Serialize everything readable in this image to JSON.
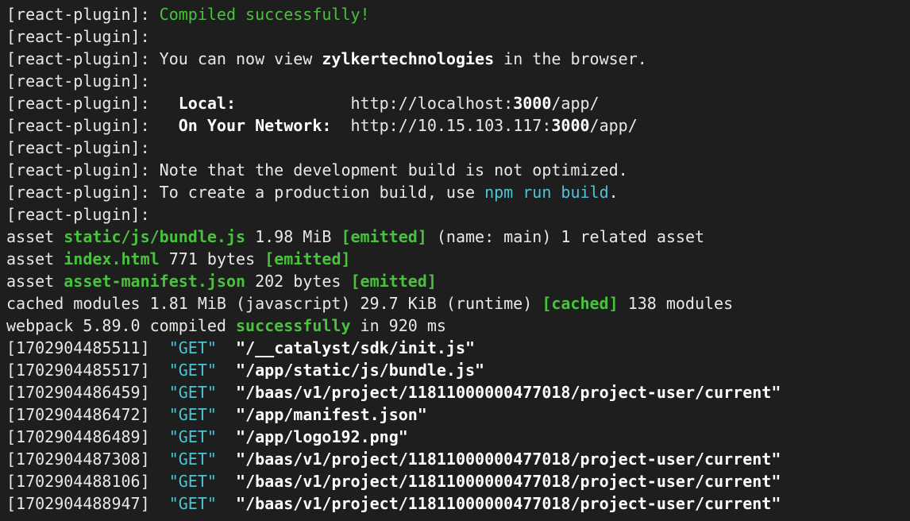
{
  "terminal": {
    "prefix": "[react-plugin]:",
    "compiled_msg": "Compiled successfully!",
    "view_intro": "You can now view",
    "app_name": "zylkertechnologies",
    "view_outro": "in the browser.",
    "local_label": "Local:",
    "local_url_pre": "http://localhost:",
    "local_port": "3000",
    "local_url_post": "/app/",
    "network_label": "On Your Network:",
    "network_url_pre": "http://10.15.103.117:",
    "network_port": "3000",
    "network_url_post": "/app/",
    "note_msg": "Note that the development build is not optimized.",
    "create_pre": "To create a production build, use",
    "create_cmd": "npm run build",
    "create_post": ".",
    "assets": [
      {
        "name": "static/js/bundle.js",
        "size": "1.98 MiB",
        "status": "[emitted]",
        "extra": "(name: main) 1 related asset"
      },
      {
        "name": "index.html",
        "size": "771 bytes",
        "status": "[emitted]",
        "extra": ""
      },
      {
        "name": "asset-manifest.json",
        "size": "202 bytes",
        "status": "[emitted]",
        "extra": ""
      }
    ],
    "asset_word": "asset",
    "cached_pre": "cached modules 1.81 MiB (javascript) 29.7 KiB (runtime)",
    "cached_tag": "[cached]",
    "cached_post": "138 modules",
    "webpack_pre": "webpack 5.89.0 compiled",
    "webpack_status": "successfully",
    "webpack_post": "in 920 ms",
    "requests": [
      {
        "ts": "[1702904485511]",
        "method": "\"GET\"",
        "path": "\"/__catalyst/sdk/init.js\""
      },
      {
        "ts": "[1702904485517]",
        "method": "\"GET\"",
        "path": "\"/app/static/js/bundle.js\""
      },
      {
        "ts": "[1702904486459]",
        "method": "\"GET\"",
        "path": "\"/baas/v1/project/11811000000477018/project-user/current\""
      },
      {
        "ts": "[1702904486472]",
        "method": "\"GET\"",
        "path": "\"/app/manifest.json\""
      },
      {
        "ts": "[1702904486489]",
        "method": "\"GET\"",
        "path": "\"/app/logo192.png\""
      },
      {
        "ts": "[1702904487308]",
        "method": "\"GET\"",
        "path": "\"/baas/v1/project/11811000000477018/project-user/current\""
      },
      {
        "ts": "[1702904488106]",
        "method": "\"GET\"",
        "path": "\"/baas/v1/project/11811000000477018/project-user/current\""
      },
      {
        "ts": "[1702904488947]",
        "method": "\"GET\"",
        "path": "\"/baas/v1/project/11811000000477018/project-user/current\""
      }
    ]
  }
}
